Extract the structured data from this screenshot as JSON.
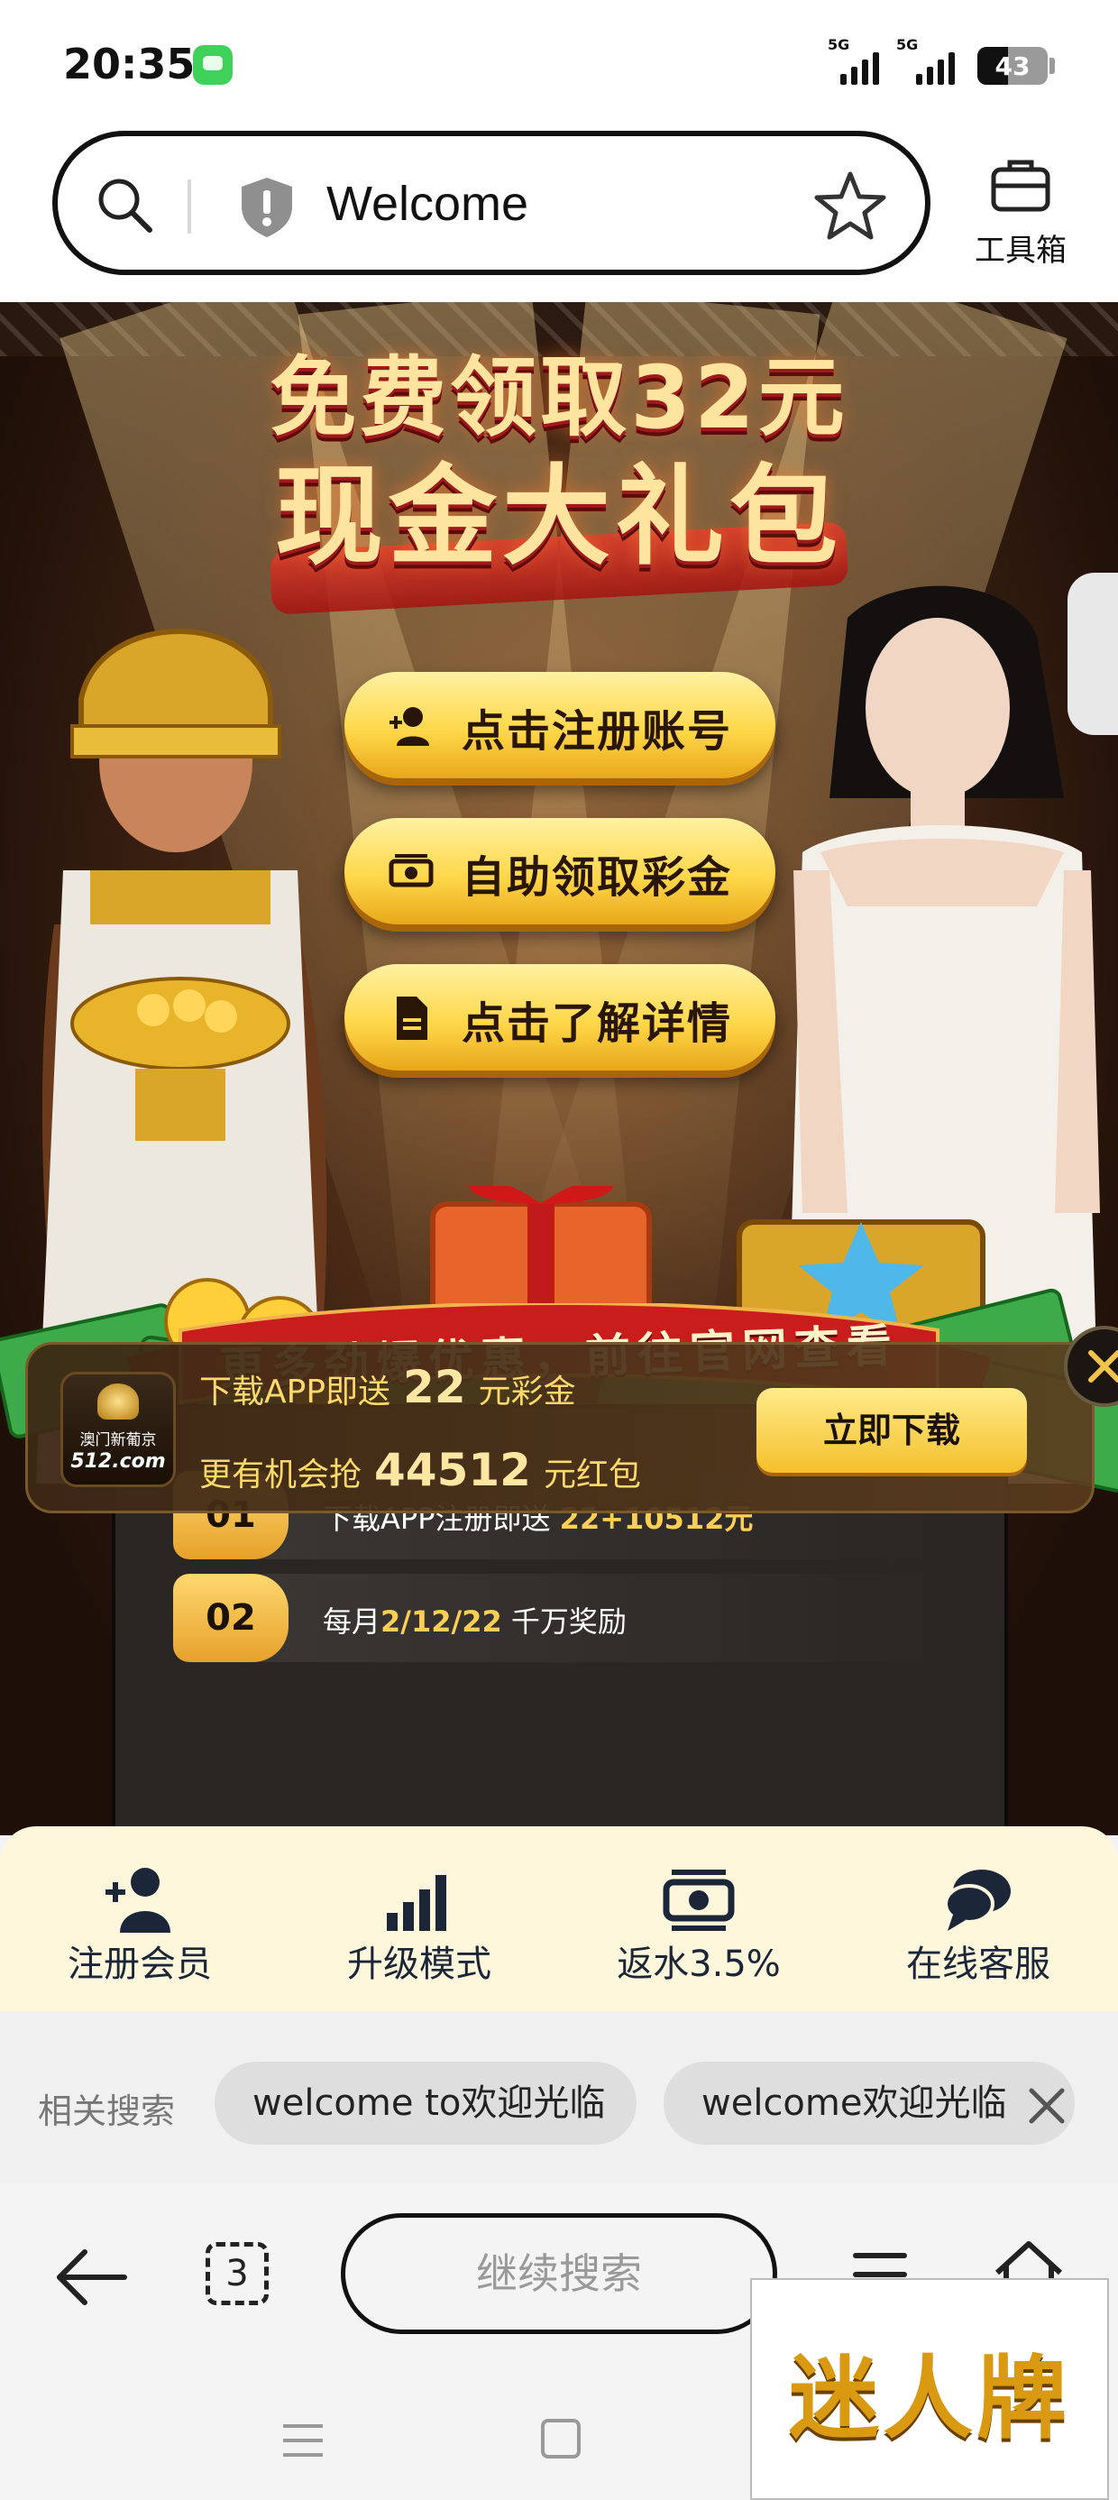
{
  "status_bar": {
    "time": "20:35",
    "signal_labels": [
      "5G",
      "5G"
    ],
    "battery_level": "43",
    "battery_fraction": 0.43
  },
  "address_bar": {
    "title": "Welcome",
    "toolbox_label": "工具箱"
  },
  "banner": {
    "headline_line1": "免费领取32元",
    "headline_line2": "现金大礼包",
    "cta_buttons": [
      {
        "label": "点击注册账号",
        "icon": "user-add-icon"
      },
      {
        "label": "自助领取彩金",
        "icon": "money-icon"
      },
      {
        "label": "点击了解详情",
        "icon": "document-icon"
      }
    ],
    "ribbon_text": "更多劲爆优惠，前往官网查看",
    "list": [
      {
        "num": "01",
        "text": "下载APP注册即送 ",
        "highlight": "22+10512元",
        "suffix": ""
      },
      {
        "num": "02",
        "text": "每月",
        "highlight": "2/12/22",
        "suffix": " 千万奖励"
      }
    ]
  },
  "download_strip": {
    "logo_cn": "澳门新葡京",
    "logo_domain": "512.com",
    "line1_prefix": "下载APP即送",
    "line1_amount": "22",
    "line1_suffix": "元彩金",
    "line2_prefix": "更有机会抢",
    "line2_amount": "44512",
    "line2_suffix": "元红包",
    "button_label": "立即下载"
  },
  "member_nav": [
    {
      "label": "注册会员",
      "icon": "user-add-icon"
    },
    {
      "label": "升级模式",
      "icon": "signal-bars-icon"
    },
    {
      "label": "返水3.5%",
      "icon": "money-icon"
    },
    {
      "label": "在线客服",
      "icon": "chat-icon"
    }
  ],
  "related_search": {
    "heading": "相关搜索",
    "chips": [
      "welcome to欢迎光临",
      "welcome欢迎光临"
    ]
  },
  "bottom_bar": {
    "tab_count": "3",
    "search_button": "继续搜索"
  },
  "watermark": "迷人牌",
  "colors": {
    "cta_gold": "#ffd84a",
    "banner_dark": "#3e2313",
    "panel": "#2a2624",
    "nav_bg": "#fff7dc",
    "nav_text": "#1b2738"
  }
}
